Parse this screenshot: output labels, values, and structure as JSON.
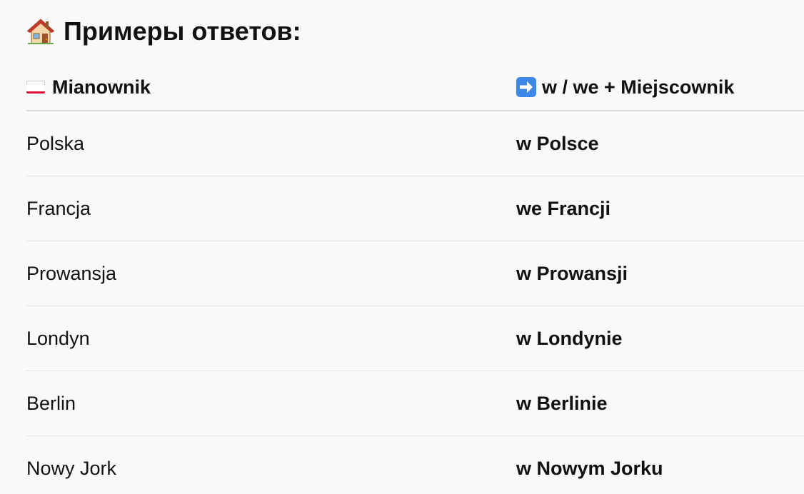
{
  "title": "Примеры ответов:",
  "icons": {
    "title_icon": "house-icon",
    "left_header_icon": "poland-flag-icon",
    "right_header_icon": "right-arrow-icon"
  },
  "table": {
    "headers": {
      "left": "Mianownik",
      "right": "w / we + Miejscownik"
    },
    "rows": [
      {
        "left": "Polska",
        "right": "w Polsce"
      },
      {
        "left": "Francja",
        "right": "we Francji"
      },
      {
        "left": "Prowansja",
        "right": "w Prowansji"
      },
      {
        "left": "Londyn",
        "right": "w Londynie"
      },
      {
        "left": "Berlin",
        "right": "w Berlinie"
      },
      {
        "left": "Nowy Jork",
        "right": "w Nowym Jorku"
      }
    ]
  },
  "colors": {
    "background": "#f9f9f9",
    "text": "#111111",
    "row_divider": "#e6e6e6",
    "header_divider": "#d8d8d8",
    "flag_red": "#dc143c",
    "arrow_blue": "#3b88e8"
  }
}
